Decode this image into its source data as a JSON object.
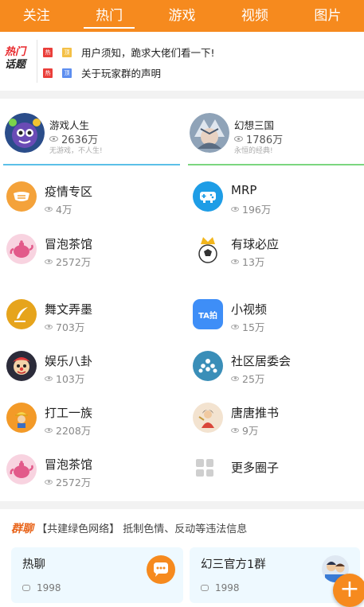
{
  "top_tabs": [
    {
      "label": "关注"
    },
    {
      "label": "热门",
      "active": true
    },
    {
      "label": "游戏"
    },
    {
      "label": "视频"
    },
    {
      "label": "图片"
    }
  ],
  "hot_topics": {
    "logo_line1": "热门",
    "logo_line2": "话题",
    "items": [
      {
        "tags": [
          "热",
          "顶"
        ],
        "text": "用户须知，跪求大佬们看一下!"
      },
      {
        "tags": [
          "热",
          "顶"
        ],
        "text": "关于玩家群的声明"
      }
    ]
  },
  "featured": [
    {
      "name": "游戏人生",
      "count": "2636万",
      "slogan": "无游戏，不人生!",
      "accent": "#5bc0e8"
    },
    {
      "name": "幻想三国",
      "count": "1786万",
      "slogan": "永恒的经典!",
      "accent": "#7bd67f"
    }
  ],
  "circles": [
    {
      "name": "疫情专区",
      "count": "4万",
      "icon": "mask-icon"
    },
    {
      "name": "MRP",
      "count": "196万",
      "icon": "gamepad-icon"
    },
    {
      "name": "冒泡茶馆",
      "count": "2572万",
      "icon": "teapot-icon"
    },
    {
      "name": "有球必应",
      "count": "13万",
      "icon": "soccer-crown-icon"
    },
    {
      "name": "舞文弄墨",
      "count": "703万",
      "icon": "quill-icon"
    },
    {
      "name": "小视频",
      "count": "15万",
      "icon": "ta-video-icon",
      "icon_text": "TA拍"
    },
    {
      "name": "娱乐八卦",
      "count": "103万",
      "icon": "clown-icon"
    },
    {
      "name": "社区居委会",
      "count": "25万",
      "icon": "community-icon"
    },
    {
      "name": "打工一族",
      "count": "2208万",
      "icon": "worker-icon"
    },
    {
      "name": "唐唐推书",
      "count": "9万",
      "icon": "book-lady-icon"
    },
    {
      "name": "冒泡茶馆",
      "count": "2572万",
      "icon": "teapot-icon"
    },
    {
      "name": "更多圈子",
      "count": "",
      "icon": "more-grid-icon"
    }
  ],
  "group_chat": {
    "title": "群聊",
    "subtitle": "【共建绿色网络】 抵制色情、反动等违法信息",
    "cards": [
      {
        "name": "热聊",
        "count": "1998"
      },
      {
        "name": "幻三官方1群",
        "count": "1998"
      }
    ],
    "fab": "+"
  },
  "colors": {
    "brand": "#f68a1e"
  }
}
